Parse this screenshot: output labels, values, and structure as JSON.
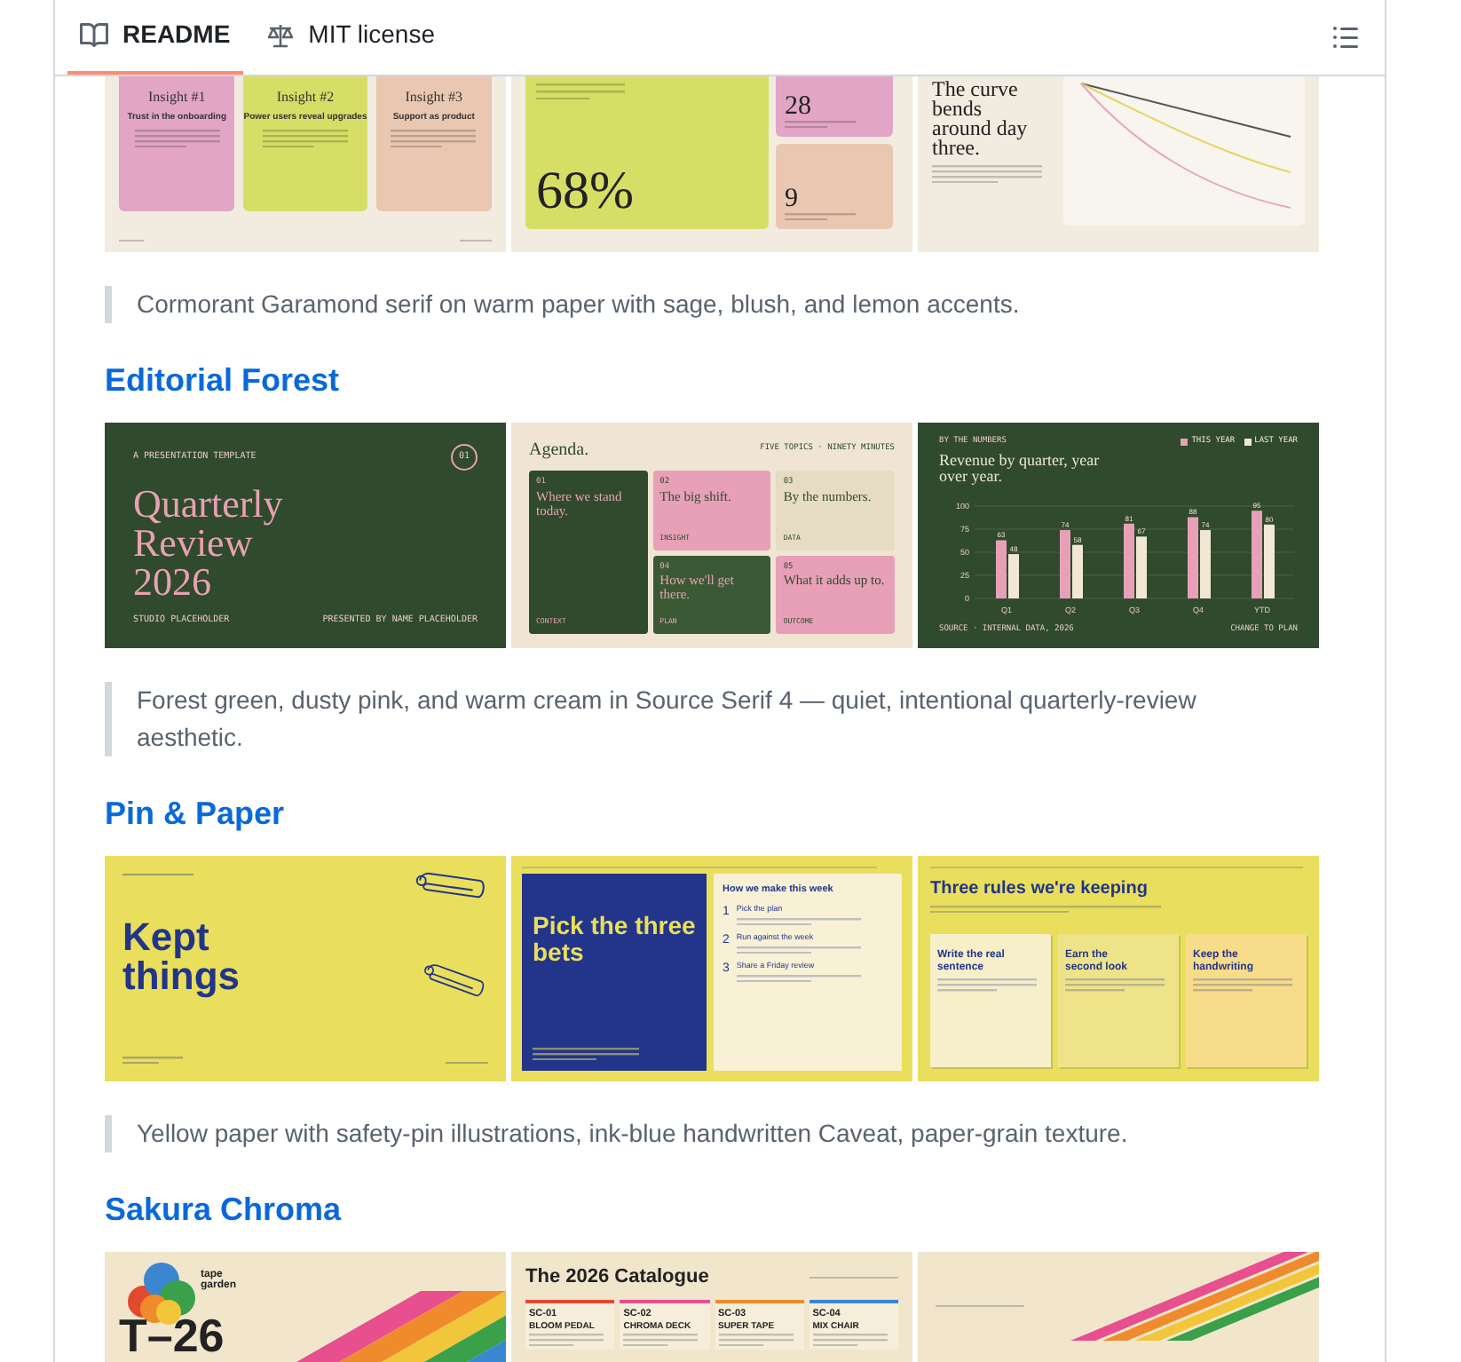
{
  "tabs": [
    {
      "label": "README",
      "selected": true,
      "kind": "book"
    },
    {
      "label": "MIT license",
      "selected": false,
      "kind": "scale"
    }
  ],
  "sections": [
    {
      "thumbnails": [
        {
          "kind": "insights",
          "cards": [
            {
              "title": "Insight #1",
              "subtitle": "Trust in the onboarding",
              "color": "#e2a5c6"
            },
            {
              "title": "Insight #2",
              "subtitle": "Power users reveal upgrades",
              "color": "#d7de66"
            },
            {
              "title": "Insight #3",
              "subtitle": "Support as product",
              "color": "#eac7b1"
            }
          ]
        },
        {
          "kind": "stats",
          "big": "68%",
          "stats": [
            {
              "value": "28",
              "color": "#e2a5c6"
            },
            {
              "value": "9",
              "color": "#eac7b1"
            }
          ]
        },
        {
          "kind": "curve",
          "headline": "The curve bends around day three."
        }
      ],
      "caption": "Cormorant Garamond serif on warm paper with sage, blush, and lemon accents."
    },
    {
      "title": "Editorial Forest",
      "thumbnails": [
        {
          "kind": "cover",
          "tag": "A PRESENTATION TEMPLATE",
          "badge": "01",
          "headline": "Quarterly Review 2026",
          "footer_left": "STUDIO PLACEHOLDER",
          "footer_right": "PRESENTED BY NAME PLACEHOLDER"
        },
        {
          "kind": "agenda",
          "headline": "Agenda.",
          "note": "FIVE TOPICS · NINETY MINUTES",
          "items": [
            {
              "number": "01",
              "title": "Where we stand today.",
              "label": "CONTEXT",
              "color": "#2f4a2c"
            },
            {
              "number": "02",
              "title": "The big shift.",
              "label": "INSIGHT",
              "color": "#e7a0b8"
            },
            {
              "number": "03",
              "title": "By the numbers.",
              "label": "DATA",
              "color": "#e6dcc3"
            },
            {
              "number": "04",
              "title": "How we'll get there.",
              "label": "PLAN",
              "color": "#3a5a36"
            },
            {
              "number": "05",
              "title": "What it adds up to.",
              "label": "OUTCOME",
              "color": "#e7a0b8"
            }
          ]
        },
        {
          "kind": "bars",
          "tag": "BY THE NUMBERS",
          "headline": "Revenue by quarter, year over year.",
          "footer_left": "SOURCE · INTERNAL DATA, 2026",
          "footer_right": "CHANGE TO PLAN",
          "chart_data": {
            "type": "bar",
            "categories": [
              "Q1",
              "Q2",
              "Q3",
              "Q4",
              "YTD"
            ],
            "series": [
              {
                "name": "THIS YEAR",
                "color": "#e7a0b8",
                "values": [
                  63,
                  74,
                  81,
                  88,
                  95
                ]
              },
              {
                "name": "LAST YEAR",
                "color": "#f1e8d4",
                "values": [
                  48,
                  58,
                  67,
                  74,
                  80
                ]
              }
            ],
            "grid": true,
            "ylim": [
              0,
              100
            ],
            "yticks": [
              0,
              25,
              50,
              75,
              100
            ],
            "data_labels": true
          }
        }
      ],
      "caption": "Forest green, dusty pink, and warm cream in Source Serif 4 — quiet, intentional quarterly-review aesthetic."
    },
    {
      "title": "Pin & Paper",
      "thumbnails": [
        {
          "kind": "pin-cover",
          "headline": "Kept things"
        },
        {
          "kind": "bets",
          "headline": "Pick the three bets",
          "panel_title": "How we make this week",
          "steps": [
            {
              "number": "1",
              "title": "Pick the plan"
            },
            {
              "number": "2",
              "title": "Run against the week"
            },
            {
              "number": "3",
              "title": "Share a Friday review"
            }
          ]
        },
        {
          "kind": "rules",
          "headline": "Three rules we're keeping",
          "cards": [
            {
              "title": "Write the real sentence",
              "color": "#f6efc9"
            },
            {
              "title": "Earn the second look",
              "color": "#efe38a"
            },
            {
              "title": "Keep the handwriting",
              "color": "#f7dc8a"
            }
          ]
        }
      ],
      "caption": "Yellow paper with safety-pin illustrations, ink-blue handwritten Caveat, paper-grain texture."
    },
    {
      "title": "Sakura Chroma",
      "thumbnails": [
        {
          "kind": "tape",
          "brand": "tape garden",
          "headline": "T–26"
        },
        {
          "kind": "catalogue",
          "headline": "The 2026 Catalogue",
          "products": [
            {
              "code": "SC-01",
              "name": "BLOOM PEDAL",
              "color": "#e24a2f"
            },
            {
              "code": "SC-02",
              "name": "CHROMA DECK",
              "color": "#e84f8f"
            },
            {
              "code": "SC-03",
              "name": "SUPER TAPE",
              "color": "#ef8b2c"
            },
            {
              "code": "SC-04",
              "name": "MIX CHAIR",
              "color": "#3b86d1"
            }
          ]
        },
        {
          "kind": "stripes"
        }
      ]
    }
  ]
}
